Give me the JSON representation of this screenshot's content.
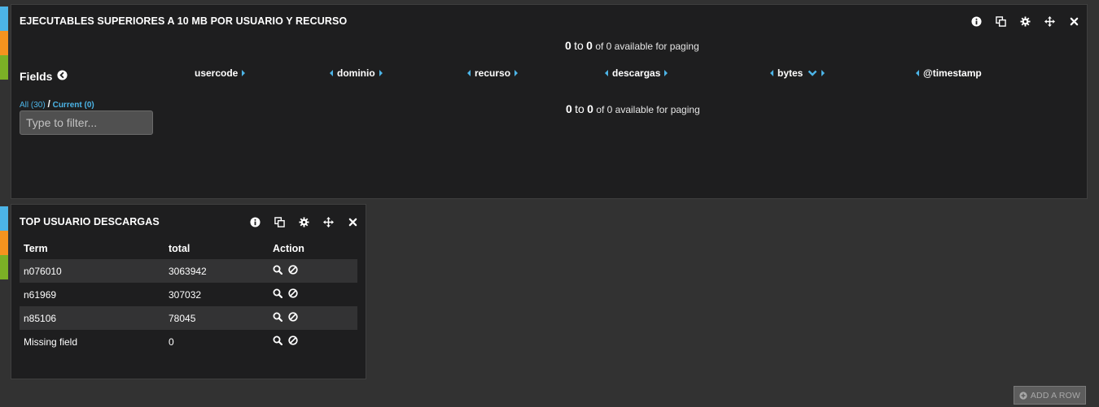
{
  "colors": {
    "accent": "#4cb4e7",
    "strip_blue": "#4cb4e7",
    "strip_orange": "#f5931e",
    "strip_green": "#7bb026",
    "panel_bg": "#1e1e1f",
    "page_bg": "#323232"
  },
  "panel1": {
    "title": "EJECUTABLES SUPERIORES A 10 MB POR USUARIO Y RECURSO",
    "icons": [
      "info-icon",
      "duplicate-icon",
      "gear-icon",
      "move-icon",
      "close-icon"
    ],
    "paging": {
      "from": "0",
      "to_word": "to",
      "to": "0",
      "rest": "of 0 available for paging"
    },
    "fields": {
      "heading": "Fields",
      "all_label": "All (30)",
      "slash": "/",
      "current_label": "Current (0)",
      "filter_placeholder": "Type to filter..."
    },
    "columns": [
      "usercode",
      "dominio",
      "recurso",
      "descargas",
      "bytes",
      "@timestamp"
    ],
    "paging_bottom": {
      "from": "0",
      "to_word": "to",
      "to": "0",
      "rest": "of 0 available for paging"
    }
  },
  "panel2": {
    "title": "TOP USUARIO DESCARGAS",
    "icons": [
      "info-icon",
      "duplicate-icon",
      "gear-icon",
      "move-icon",
      "close-icon"
    ],
    "headers": [
      "Term",
      "total",
      "Action"
    ],
    "rows": [
      {
        "term": "n076010",
        "total": "3063942"
      },
      {
        "term": "n61969",
        "total": "307032"
      },
      {
        "term": "n85106",
        "total": "78045"
      },
      {
        "term": "Missing field",
        "total": "0"
      }
    ]
  },
  "add_row": {
    "label": "ADD A ROW",
    "icon": "plus-circle-icon"
  }
}
